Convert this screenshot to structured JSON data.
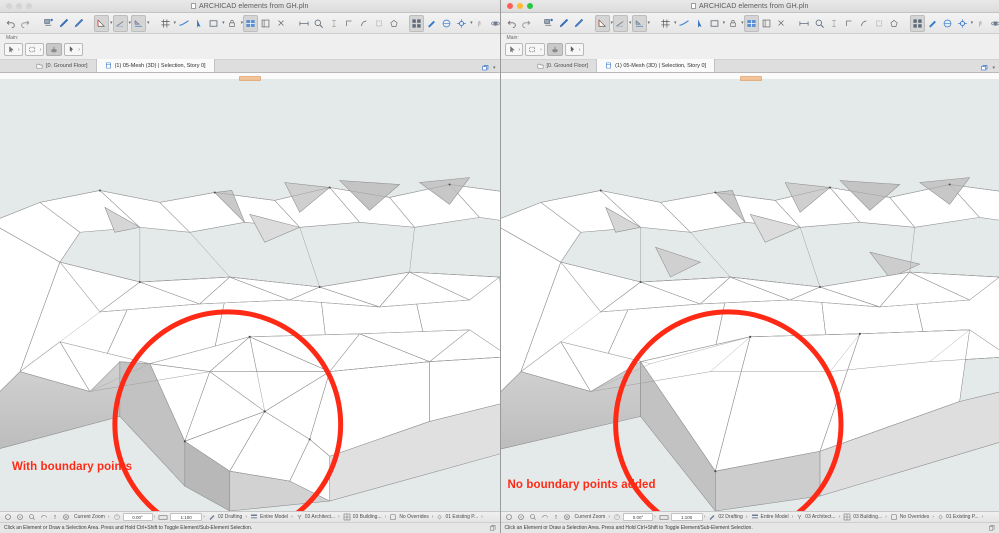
{
  "meta": {
    "app": "ARCHICAD",
    "accent_red": "#ff2a16",
    "viewport_bg": "#e4eaea"
  },
  "windows": [
    {
      "id": "left",
      "active": false,
      "title": "ARCHICAD elements from GH.pln",
      "callout": "With boundary points",
      "traffic_lights": [
        "close",
        "minimize",
        "maximize"
      ]
    },
    {
      "id": "right",
      "active": true,
      "title": "ARCHICAD elements from GH.pln",
      "callout": "No boundary points added",
      "traffic_lights": [
        "close",
        "minimize",
        "maximize"
      ]
    }
  ],
  "toolbar": {
    "groups": [
      {
        "name": "history",
        "items": [
          {
            "icon": "undo-icon",
            "label": "Undo",
            "boxed": false
          },
          {
            "icon": "redo-icon",
            "label": "Redo",
            "boxed": false
          }
        ]
      },
      {
        "name": "edit-tools",
        "items": [
          {
            "icon": "magic-wand-icon",
            "label": "Magic Wand",
            "boxed": false
          },
          {
            "icon": "pencil-icon",
            "label": "Pencil",
            "boxed": false
          },
          {
            "icon": "pen-icon",
            "label": "Pen",
            "boxed": false
          }
        ]
      },
      {
        "name": "transform-tools",
        "items": [
          {
            "icon": "drag-icon",
            "label": "Drag",
            "boxed": true,
            "caret": true
          },
          {
            "icon": "rotate-icon",
            "label": "Rotate",
            "boxed": true,
            "caret": true
          },
          {
            "icon": "mirror-icon",
            "label": "Mirror",
            "boxed": true,
            "caret": true
          }
        ]
      },
      {
        "name": "grid-tools",
        "items": [
          {
            "icon": "grid-icon",
            "label": "Grid Snap",
            "boxed": false,
            "caret": true
          },
          {
            "icon": "curve-icon",
            "label": "Curve",
            "boxed": false
          },
          {
            "icon": "cursor-snap-icon",
            "label": "Cursor Snap",
            "boxed": false
          }
        ]
      },
      {
        "name": "view-tools",
        "items": [
          {
            "icon": "rectangle-icon",
            "label": "Rectangle Selection",
            "boxed": false,
            "caret": true
          },
          {
            "icon": "lock-icon",
            "label": "Lock",
            "boxed": false,
            "caret": true
          },
          {
            "icon": "3d-view-icon",
            "label": "3D View",
            "boxed": true
          },
          {
            "icon": "elevation-icon",
            "label": "Elevation",
            "boxed": false
          },
          {
            "icon": "close-view-icon",
            "label": "Close View",
            "boxed": false
          }
        ]
      },
      {
        "name": "measure-tools",
        "items": [
          {
            "icon": "measure-icon",
            "label": "Measure",
            "boxed": false
          },
          {
            "icon": "zoom-icon",
            "label": "Zoom",
            "boxed": false
          },
          {
            "icon": "vertical-icon",
            "label": "Vertical",
            "boxed": false
          },
          {
            "icon": "corner-left-icon",
            "label": "Corner",
            "boxed": false
          },
          {
            "icon": "arc-icon",
            "label": "Arc",
            "boxed": false
          },
          {
            "icon": "box-icon",
            "label": "Box",
            "boxed": false
          },
          {
            "icon": "polygon-icon",
            "label": "Polygon",
            "boxed": false
          }
        ]
      },
      {
        "name": "render-tools",
        "items": [
          {
            "icon": "layers-icon",
            "label": "Layers",
            "boxed": true
          },
          {
            "icon": "paint-icon",
            "label": "Paint",
            "boxed": false
          },
          {
            "icon": "globe-icon",
            "label": "Globe",
            "boxed": false
          },
          {
            "icon": "settings-gear-icon",
            "label": "Settings",
            "boxed": false,
            "caret": true
          },
          {
            "icon": "hand-icon",
            "label": "Hand",
            "boxed": false
          },
          {
            "icon": "orbit-icon",
            "label": "Orbit",
            "boxed": false
          },
          {
            "icon": "power-icon",
            "label": "Render",
            "boxed": false
          }
        ]
      }
    ]
  },
  "palette": {
    "label": "Main:",
    "buttons": [
      {
        "icon": "arrow-select-icon",
        "label": "Arrow",
        "state": "framed",
        "caret": true
      },
      {
        "icon": "marquee-icon",
        "label": "Marquee",
        "state": "framed",
        "caret": true
      },
      {
        "icon": "object-icon",
        "label": "Object",
        "state": "pressed",
        "caret": false
      },
      {
        "icon": "mesh-icon",
        "label": "Mesh",
        "state": "framed",
        "caret": true
      }
    ]
  },
  "tabs": [
    {
      "label": "[0. Ground Floor]",
      "icon": "floorplan-icon",
      "selected": false
    },
    {
      "label": "(1) 05-Mesh (3D) | Selection, Story 0]",
      "icon": "3d-window-icon",
      "selected": true
    }
  ],
  "tab_right": [
    {
      "icon": "restore-window-icon",
      "label": "Restore"
    },
    {
      "icon": "chevron-down-icon",
      "label": "More"
    }
  ],
  "statusbar": {
    "nav_icons": [
      {
        "icon": "fit-in-window-icon",
        "label": "Fit in Window"
      },
      {
        "icon": "previous-zoom-icon",
        "label": "Previous Zoom"
      },
      {
        "icon": "zoom-in-icon",
        "label": "Zoom In"
      },
      {
        "icon": "pan-icon",
        "label": "Pan"
      },
      {
        "icon": "orbit-small-icon",
        "label": "Orbit"
      },
      {
        "icon": "zoom-reset-icon",
        "label": "Reset Zoom"
      }
    ],
    "zoom_label": "Current Zoom",
    "orientation_value": "0.00°",
    "scale_value": "1:100",
    "items": [
      {
        "icon": "pen-set-icon",
        "label": "02 Drafting"
      },
      {
        "icon": "layer-combo-icon",
        "label": "Entire Model"
      },
      {
        "icon": "structure-icon",
        "label": "03 Architect..."
      },
      {
        "icon": "penset-grid-icon",
        "label": "03 Building..."
      },
      {
        "icon": "override-icon",
        "label": "No Overrides"
      },
      {
        "icon": "renovation-icon",
        "label": "01 Existing P..."
      }
    ]
  },
  "message": {
    "text": "Click an Element or Draw a Selection Area. Press and Hold Ctrl+Shift to Toggle Element/Sub-Element Selection.",
    "right_icon": "copy-icon"
  }
}
